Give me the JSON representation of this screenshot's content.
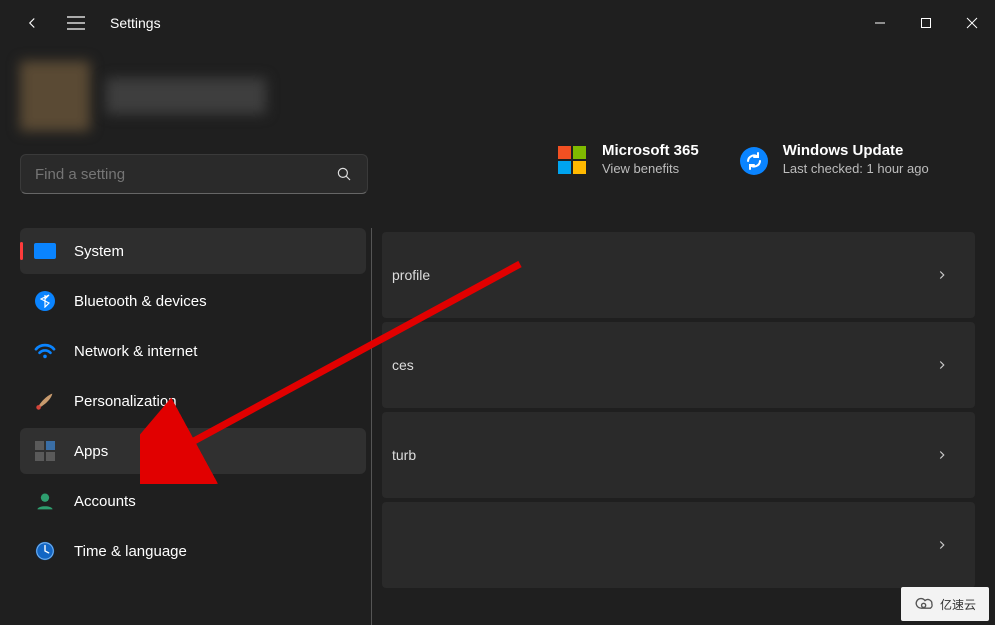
{
  "titlebar": {
    "title": "Settings"
  },
  "search": {
    "placeholder": "Find a setting"
  },
  "nav": {
    "items": [
      {
        "label": "System"
      },
      {
        "label": "Bluetooth & devices"
      },
      {
        "label": "Network & internet"
      },
      {
        "label": "Personalization"
      },
      {
        "label": "Apps"
      },
      {
        "label": "Accounts"
      },
      {
        "label": "Time & language"
      }
    ]
  },
  "cards": {
    "ms365": {
      "title": "Microsoft 365",
      "subtitle": "View benefits"
    },
    "update": {
      "title": "Windows Update",
      "subtitle": "Last checked: 1 hour ago"
    }
  },
  "rows": {
    "r0": {
      "fragment": "profile"
    },
    "r1": {
      "fragment": "ces"
    },
    "r2": {
      "fragment": "turb"
    },
    "r3": {
      "fragment": ""
    }
  },
  "watermark": {
    "text": "亿速云"
  }
}
